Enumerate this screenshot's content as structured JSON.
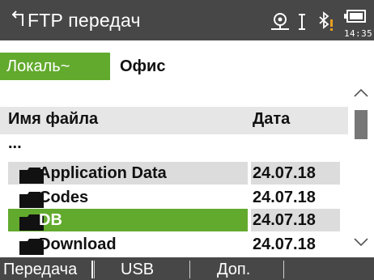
{
  "header": {
    "title": "FTP передач",
    "clock": "14:35",
    "icons": [
      "back-arrow-icon",
      "target-icon",
      "text-cursor-icon",
      "bluetooth-warning-icon",
      "battery-icon"
    ]
  },
  "tabs": [
    {
      "label": "Локаль~",
      "active": true
    },
    {
      "label": "Офис",
      "active": false
    }
  ],
  "table": {
    "columns": {
      "name": "Имя файла",
      "date": "Дата"
    },
    "parent_label": "...",
    "rows": [
      {
        "name": "Application Data",
        "date": "24.07.18",
        "state": "shaded"
      },
      {
        "name": "Codes",
        "date": "24.07.18",
        "state": "normal"
      },
      {
        "name": "DB",
        "date": "24.07.18",
        "state": "selected"
      },
      {
        "name": "Download",
        "date": "24.07.18",
        "state": "normal"
      }
    ]
  },
  "softkeys": [
    "Передача",
    "USB",
    "Доп.",
    ""
  ],
  "colors": {
    "accent": "#62aa2d",
    "bar": "#474747",
    "shade": "#dcdcdc"
  }
}
